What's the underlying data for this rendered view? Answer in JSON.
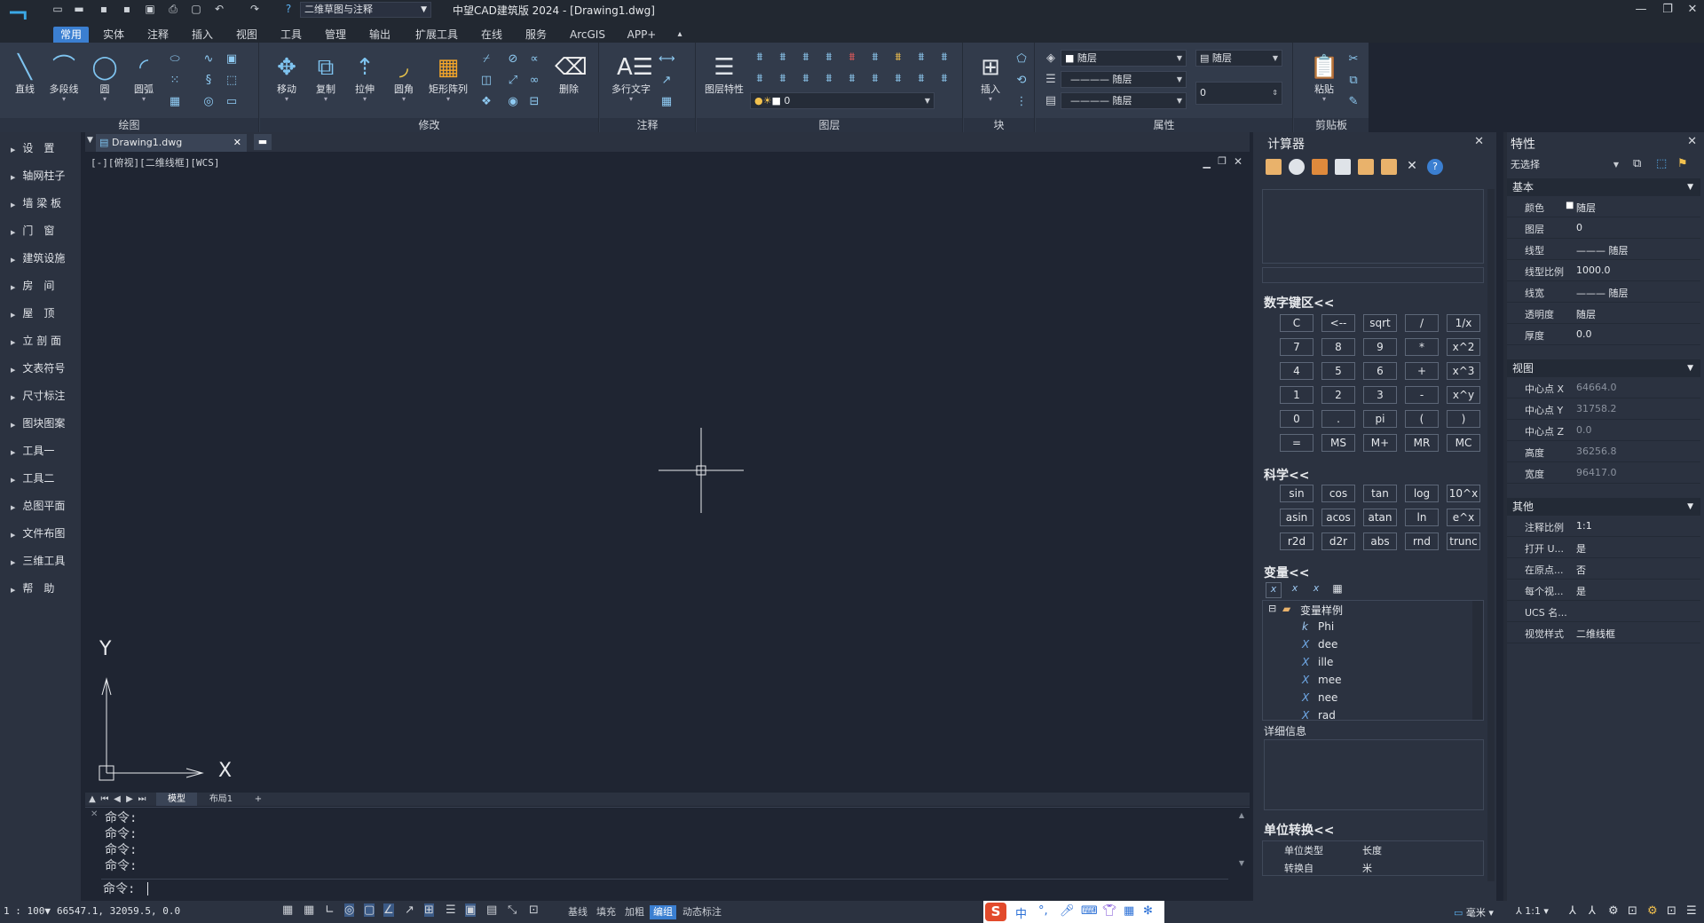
{
  "app": {
    "title": "中望CAD建筑版 2024 - [Drawing1.dwg]",
    "workspace": "二维草图与注释"
  },
  "menu": [
    "常用",
    "实体",
    "注释",
    "插入",
    "视图",
    "工具",
    "管理",
    "输出",
    "扩展工具",
    "在线",
    "服务",
    "ArcGIS",
    "APP+"
  ],
  "ribbon": {
    "draw": {
      "label": "绘图",
      "buttons": [
        "直线",
        "多段线",
        "圆",
        "圆弧"
      ]
    },
    "modify": {
      "label": "修改",
      "buttons": [
        "移动",
        "复制",
        "拉伸",
        "圆角",
        "矩形阵列",
        "删除"
      ]
    },
    "annotate": {
      "label": "注释",
      "buttons": [
        "多行文字"
      ]
    },
    "layer": {
      "label": "图层",
      "buttons": [
        "图层特性"
      ],
      "current": "0"
    },
    "block": {
      "label": "块",
      "buttons": [
        "插入"
      ]
    },
    "properties": {
      "label": "属性",
      "color": "随层",
      "linetype": "随层",
      "lineweight": "随层",
      "plotstyle": "随层",
      "transparency": "0"
    },
    "clipboard": {
      "label": "剪贴板",
      "buttons": [
        "粘贴"
      ]
    }
  },
  "left_panel": [
    "设　置",
    "轴网柱子",
    "墙 梁 板",
    "门　窗",
    "建筑设施",
    "房　间",
    "屋　顶",
    "立 剖 面",
    "文表符号",
    "尺寸标注",
    "图块图案",
    "工具一",
    "工具二",
    "总图平面",
    "文件布图",
    "三维工具",
    "帮　助"
  ],
  "document": {
    "tab": "Drawing1.dwg",
    "viewport_label": "[-][俯视][二维线框][WCS]"
  },
  "ucs": {
    "x": "X",
    "y": "Y"
  },
  "layout_tabs": [
    "模型",
    "布局1",
    "+"
  ],
  "command": {
    "lines": [
      "命令:",
      "命令:",
      "命令:",
      "命令:"
    ],
    "prompt": "命令:"
  },
  "status": {
    "scale": "1 : 100▼",
    "coords": "66547.1, 32059.5, 0.0",
    "toggles": [
      "基线",
      "填充",
      "加粗",
      "编组",
      "动态标注"
    ],
    "active_toggle": "编组",
    "unit": "毫米",
    "anno_scale": "1:1"
  },
  "calculator": {
    "title": "计算器",
    "numpad_title": "数字键区<<",
    "numpad": [
      [
        "C",
        "<--",
        "sqrt",
        "/",
        "1/x"
      ],
      [
        "7",
        "8",
        "9",
        "*",
        "x^2"
      ],
      [
        "4",
        "5",
        "6",
        "+",
        "x^3"
      ],
      [
        "1",
        "2",
        "3",
        "-",
        "x^y"
      ],
      [
        "0",
        ".",
        "pi",
        "(",
        ")"
      ],
      [
        "=",
        "MS",
        "M+",
        "MR",
        "MC"
      ]
    ],
    "sci_title": "科学<<",
    "sci": [
      [
        "sin",
        "cos",
        "tan",
        "log",
        "10^x"
      ],
      [
        "asin",
        "acos",
        "atan",
        "ln",
        "e^x"
      ],
      [
        "r2d",
        "d2r",
        "abs",
        "rnd",
        "trunc"
      ]
    ],
    "var_title": "变量<<",
    "var_folder": "变量样例",
    "vars": [
      {
        "t": "k",
        "n": "Phi"
      },
      {
        "t": "X",
        "n": "dee"
      },
      {
        "t": "X",
        "n": "ille"
      },
      {
        "t": "X",
        "n": "mee"
      },
      {
        "t": "X",
        "n": "nee"
      },
      {
        "t": "X",
        "n": "rad"
      }
    ],
    "detail_title": "详细信息",
    "unit_title": "单位转换<<",
    "unit_rows": [
      [
        "单位类型",
        "长度"
      ],
      [
        "转换自",
        "米"
      ]
    ]
  },
  "properties": {
    "title": "特性",
    "selection": "无选择",
    "basic_label": "基本",
    "basic": [
      [
        "颜色",
        "随层"
      ],
      [
        "图层",
        "0"
      ],
      [
        "线型",
        "——— 随层"
      ],
      [
        "线型比例",
        "1000.0"
      ],
      [
        "线宽",
        "——— 随层"
      ],
      [
        "透明度",
        "随层"
      ],
      [
        "厚度",
        "0.0"
      ]
    ],
    "view_label": "视图",
    "view": [
      [
        "中心点 X",
        "64664.0"
      ],
      [
        "中心点 Y",
        "31758.2"
      ],
      [
        "中心点 Z",
        "0.0"
      ],
      [
        "高度",
        "36256.8"
      ],
      [
        "宽度",
        "96417.0"
      ]
    ],
    "other_label": "其他",
    "other": [
      [
        "注释比例",
        "1:1"
      ],
      [
        "打开 U...",
        "是"
      ],
      [
        "在原点...",
        "否"
      ],
      [
        "每个视...",
        "是"
      ],
      [
        "UCS 名...",
        ""
      ],
      [
        "视觉样式",
        "二维线框"
      ]
    ]
  }
}
